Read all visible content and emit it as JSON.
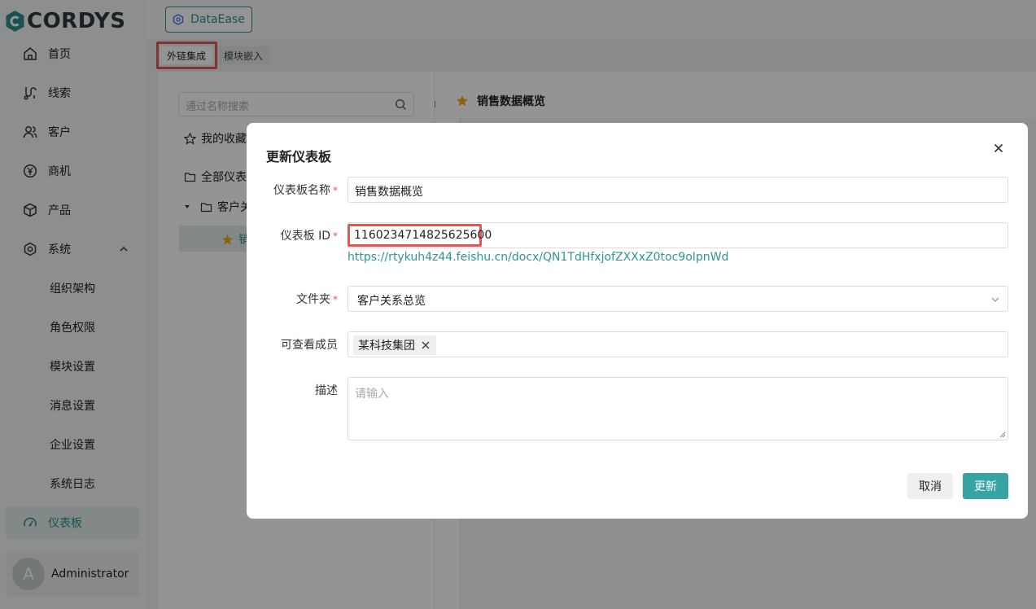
{
  "brand": {
    "name": "CORDYS",
    "color": "#2f8c8f"
  },
  "sidebar": {
    "items": [
      {
        "label": "首页",
        "icon": "home-icon"
      },
      {
        "label": "线索",
        "icon": "clue-icon"
      },
      {
        "label": "客户",
        "icon": "customer-icon"
      },
      {
        "label": "商机",
        "icon": "opportunity-icon"
      },
      {
        "label": "产品",
        "icon": "product-icon"
      },
      {
        "label": "系统",
        "icon": "gear-icon",
        "expanded": true
      }
    ],
    "sub_items": [
      {
        "label": "组织架构"
      },
      {
        "label": "角色权限"
      },
      {
        "label": "模块设置"
      },
      {
        "label": "消息设置"
      },
      {
        "label": "企业设置"
      },
      {
        "label": "系统日志"
      }
    ],
    "active_item": {
      "label": "仪表板",
      "icon": "dashboard-icon"
    },
    "user": {
      "avatar_letter": "A",
      "name": "Administrator"
    }
  },
  "header": {
    "dataease_label": "DataEase"
  },
  "tabs": [
    {
      "label": "外链集成",
      "selected": true
    },
    {
      "label": "模块嵌入",
      "selected": false
    }
  ],
  "tree": {
    "search_placeholder": "通过名称搜索",
    "favorites_label": "我的收藏",
    "all_label": "全部仪表",
    "folder_label": "客户关",
    "selected_item_label": "销"
  },
  "dashboard": {
    "title": "销售数据概览"
  },
  "dialog": {
    "title": "更新仪表板",
    "fields": {
      "name": {
        "label": "仪表板名称",
        "value": "销售数据概览",
        "required": true
      },
      "id": {
        "label": "仪表板 ID",
        "value": "1160234714825625600",
        "required": true,
        "link": "https://rtykuh4z44.feishu.cn/docx/QN1TdHfxjofZXXxZ0toc9oIpnWd"
      },
      "folder": {
        "label": "文件夹",
        "value": "客户关系总览",
        "required": true
      },
      "members": {
        "label": "可查看成员",
        "tags": [
          "某科技集团"
        ]
      },
      "description": {
        "label": "描述",
        "placeholder": "请输入"
      }
    },
    "cancel_label": "取消",
    "update_label": "更新"
  },
  "colors": {
    "accent": "#36a3a5",
    "highlight": "#e35656",
    "link": "#2f9597"
  }
}
